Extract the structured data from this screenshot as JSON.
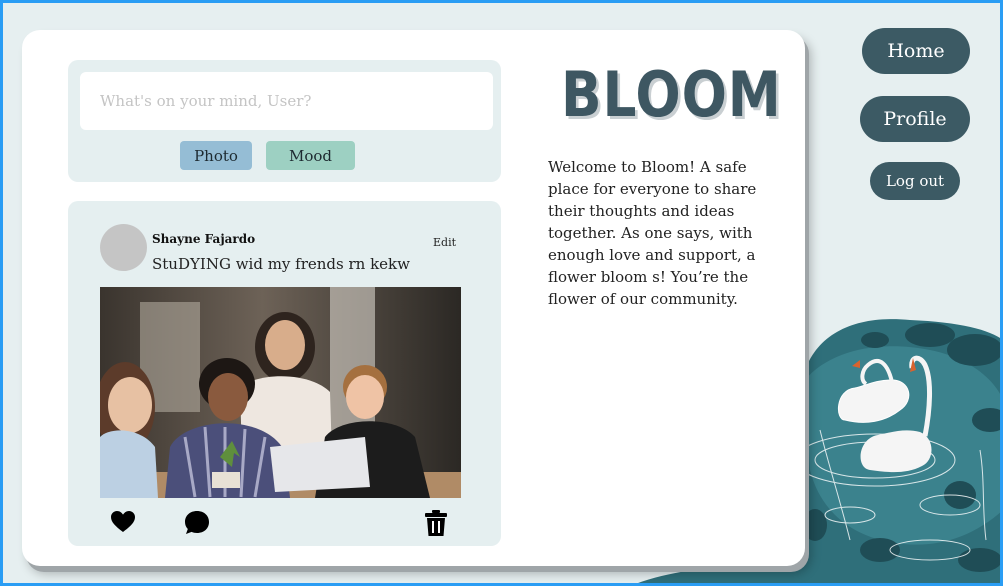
{
  "app": {
    "logo_text": "BLOOM"
  },
  "composer": {
    "placeholder": "What's on your mind, User?",
    "photo_label": "Photo",
    "mood_label": "Mood"
  },
  "post": {
    "author": "Shayne Fajardo",
    "text": "StuDYING wid my frends rn kekw",
    "edit_label": "Edit",
    "actions": [
      "heart-icon",
      "comment-icon",
      "trash-icon"
    ]
  },
  "about": {
    "welcome_text": "Welcome to Bloom! A safe place for everyone to share their thoughts and ideas together. As one says, with enough love and support, a flower bloom s! You’re the flower of our community."
  },
  "nav": {
    "home": "Home",
    "profile": "Profile",
    "logout": "Log out"
  },
  "colors": {
    "nav_button": "#3c5a64",
    "panel": "#e5eff0",
    "photo_chip": "#95bdd5",
    "mood_chip": "#9dd0c2",
    "page_border": "#2a9df4"
  }
}
